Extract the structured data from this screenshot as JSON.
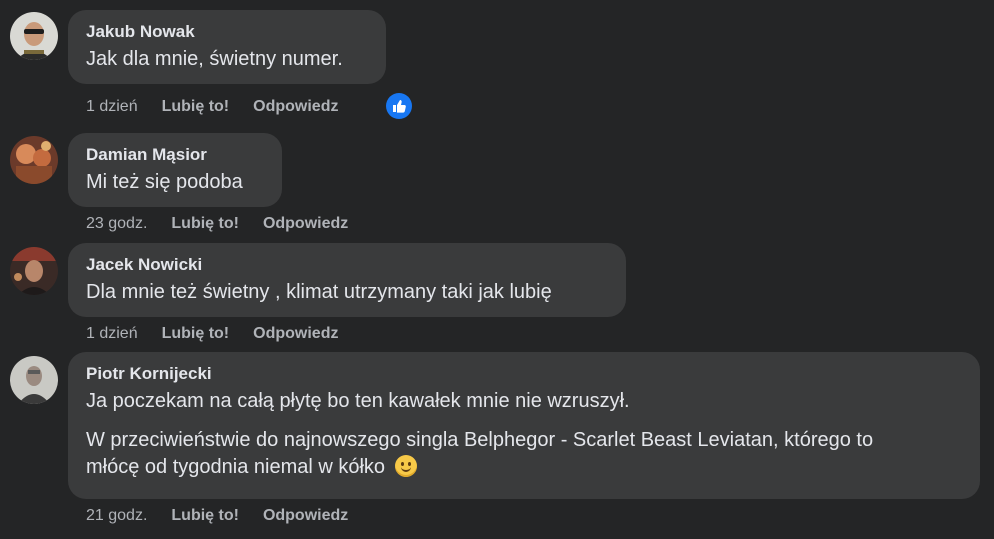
{
  "comments": [
    {
      "author": "Jakub Nowak",
      "paragraphs": [
        "Jak dla mnie, świetny numer."
      ],
      "time": "1 dzień",
      "like_label": "Lubię to!",
      "reply_label": "Odpowiedz",
      "reaction": "like-reaction-icon"
    },
    {
      "author": "Damian Mąsior",
      "paragraphs": [
        "Mi też się podoba"
      ],
      "time": "23 godz.",
      "like_label": "Lubię to!",
      "reply_label": "Odpowiedz"
    },
    {
      "author": "Jacek Nowicki",
      "paragraphs": [
        "Dla mnie też świetny , klimat utrzymany taki jak lubię"
      ],
      "time": "1 dzień",
      "like_label": "Lubię to!",
      "reply_label": "Odpowiedz"
    },
    {
      "author": "Piotr Kornijecki",
      "paragraphs": [
        "Ja poczekam na całą płytę bo ten kawałek mnie nie wzruszył.",
        "W przeciwieństwie do najnowszego singla Belphegor - Scarlet Beast Leviatan, którego to",
        "młócę od tygodnia niemal w kółko"
      ],
      "time": "21 godz.",
      "like_label": "Lubię to!",
      "reply_label": "Odpowiedz",
      "trailing_emoji": "slightly-smiling-face-emoji"
    }
  ],
  "colors": {
    "background": "#242526",
    "bubble": "#3a3b3c",
    "primary_text": "#e4e6eb",
    "secondary_text": "#b0b3b8",
    "reaction_blue": "#1877f2"
  }
}
